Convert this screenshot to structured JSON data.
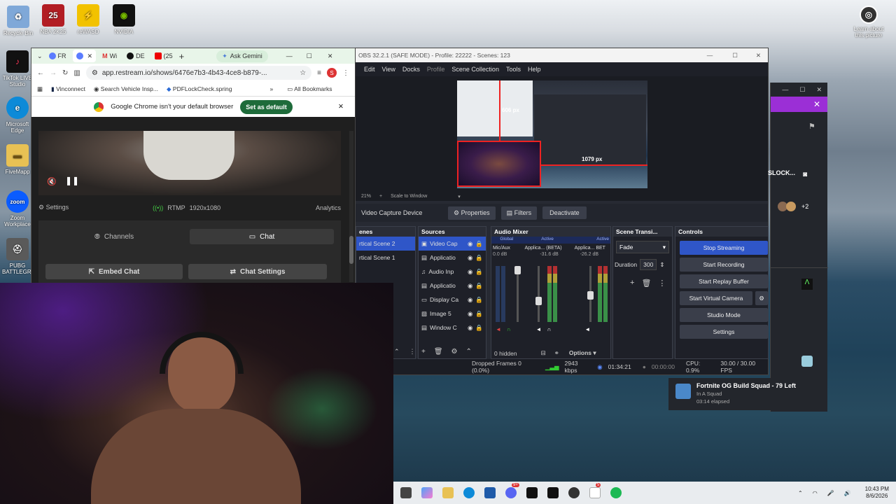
{
  "desktop": {
    "icons": [
      {
        "label": "Recycle Bin",
        "icon": "recycle-bin-icon",
        "color": "#7fa8d8"
      },
      {
        "label": "NBA 2K25",
        "icon": "nba2k-icon",
        "color": "#b21d24"
      },
      {
        "label": "reWASD",
        "icon": "rewasd-icon",
        "color": "#f2c200"
      },
      {
        "label": "NVIDIA",
        "icon": "nvidia-icon",
        "color": "#76b900"
      },
      {
        "label": "TikTok LIVE Studio",
        "icon": "tiktok-icon",
        "color": "#111111"
      },
      {
        "label": "Microsoft Edge",
        "icon": "edge-icon",
        "color": "#0d8ad8"
      },
      {
        "label": "FiveMapp",
        "icon": "folder-icon",
        "color": "#e8c154"
      },
      {
        "label": "Zoom Workplace",
        "icon": "zoom-icon",
        "color": "#0b5cff"
      },
      {
        "label": "PUBG BATTLEGR...",
        "icon": "pubg-icon",
        "color": "#5a5a5a"
      },
      {
        "label": "Learn about this picture",
        "icon": "camera-icon",
        "color": "#333333"
      }
    ]
  },
  "chrome": {
    "tabs": [
      "FR",
      "",
      "Wi",
      "DE",
      "(25"
    ],
    "gemini": "Ask Gemini",
    "url": "app.restream.io/shows/6476e7b3-4b43-4ce8-b879-...",
    "profile": "S",
    "bookmarks": [
      "Vinconnect",
      "Search Vehicle Insp...",
      "PDFLockCheck.spring"
    ],
    "all_bookmarks": "All Bookmarks",
    "notice": "Google Chrome isn't your default browser",
    "set_default": "Set as default",
    "settings": "Settings",
    "rtmp": "RTMP",
    "resolution": "1920x1080",
    "analytics": "Analytics",
    "channels": "Channels",
    "chat": "Chat",
    "embed_chat": "Embed Chat",
    "chat_settings": "Chat Settings"
  },
  "obs": {
    "title": "OBS 32.2.1 (SAFE MODE) - Profile: 22222 - Scenes: 123",
    "menu": [
      "Edit",
      "View",
      "Docks",
      "Profile",
      "Scene Collection",
      "Tools",
      "Help"
    ],
    "preview": {
      "label_606": "606 px",
      "label_1079": "1079 px",
      "zoom": "21%",
      "scale": "Scale to Window"
    },
    "source_bar": {
      "name": "Video Capture Device",
      "properties": "Properties",
      "filters": "Filters",
      "deactivate": "Deactivate"
    },
    "scenes": {
      "title": "enes",
      "items": [
        "rtical Scene 2",
        "rtical Scene 1"
      ]
    },
    "sources": {
      "title": "Sources",
      "items": [
        "Video Cap",
        "Applicatio",
        "Audio Inp",
        "Applicatio",
        "Display Ca",
        "Image 5",
        "Window C"
      ]
    },
    "mixer": {
      "title": "Audio Mixer",
      "ch1": "Global",
      "ch2": "Active",
      "ch3": "Active",
      "names": [
        "Mic/Aux",
        "Applica... (BETA)",
        "Applica... BET"
      ],
      "db": [
        "0.0 dB",
        "-31.6 dB",
        "-26.2 dB"
      ],
      "hidden": "0 hidden",
      "options": "Options"
    },
    "transitions": {
      "title": "Scene Transi...",
      "type": "Fade",
      "duration_label": "Duration",
      "duration": "300"
    },
    "controls": {
      "title": "Controls",
      "buttons": [
        "Stop Streaming",
        "Start Recording",
        "Start Replay Buffer",
        "Start Virtual Camera",
        "Studio Mode",
        "Settings"
      ]
    },
    "status": {
      "dropped": "Dropped Frames 0 (0.0%)",
      "kbps": "2943 kbps",
      "live": "01:34:21",
      "rec": "00:00:00",
      "cpu": "CPU: 0.9%",
      "fps": "30.00 / 30.00 FPS"
    }
  },
  "xbox": {
    "lock": "SLOCK...",
    "plus": "+2",
    "notif_title": "Fortnite OG Build Squad - 79 Left",
    "notif_sub": "In A Squad",
    "notif_time": "03:14 elapsed"
  },
  "taskbar": {
    "time": "10:43 PM",
    "date": "8/6/2026",
    "badge1": "9+",
    "badge2": "5"
  }
}
